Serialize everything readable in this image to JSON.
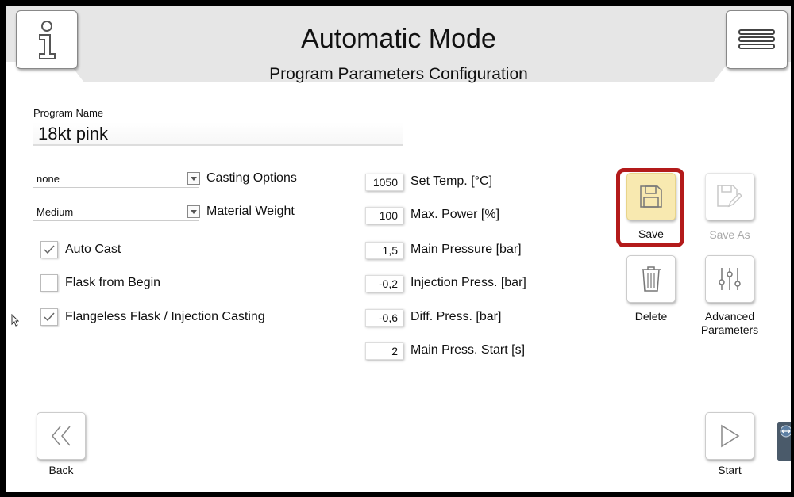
{
  "header": {
    "title": "Automatic Mode",
    "subtitle": "Program Parameters Configuration"
  },
  "program": {
    "name_label": "Program Name",
    "name_value": "18kt pink"
  },
  "dropdowns": [
    {
      "value": "none",
      "label": "Casting Options"
    },
    {
      "value": "Medium",
      "label": "Material Weight"
    }
  ],
  "checkboxes": [
    {
      "label": "Auto Cast",
      "checked": true
    },
    {
      "label": "Flask from Begin",
      "checked": false
    },
    {
      "label": "Flangeless Flask / Injection Casting",
      "checked": true
    }
  ],
  "parameters": [
    {
      "value": "1050",
      "label": "Set Temp. [°C]"
    },
    {
      "value": "100",
      "label": "Max. Power [%]"
    },
    {
      "value": "1,5",
      "label": "Main Pressure [bar]"
    },
    {
      "value": "-0,2",
      "label": "Injection Press. [bar]"
    },
    {
      "value": "-0,6",
      "label": "Diff. Press. [bar]"
    },
    {
      "value": "2",
      "label": "Main Press. Start [s]"
    }
  ],
  "actions": {
    "save": "Save",
    "save_as": "Save As",
    "delete": "Delete",
    "advanced_line1": "Advanced",
    "advanced_line2": "Parameters"
  },
  "nav": {
    "back": "Back",
    "start": "Start"
  },
  "icons": {
    "info": "info-icon",
    "menu": "hamburger-menu-icon",
    "save": "floppy-disk-icon",
    "save_as": "floppy-edit-icon",
    "delete": "trash-icon",
    "advanced": "sliders-icon",
    "back": "double-chevron-left-icon",
    "start": "play-triangle-icon"
  },
  "colors": {
    "save_highlight": "#f8e9b0",
    "save_frame": "#b31a1a",
    "header_band": "#e6e6e6"
  }
}
